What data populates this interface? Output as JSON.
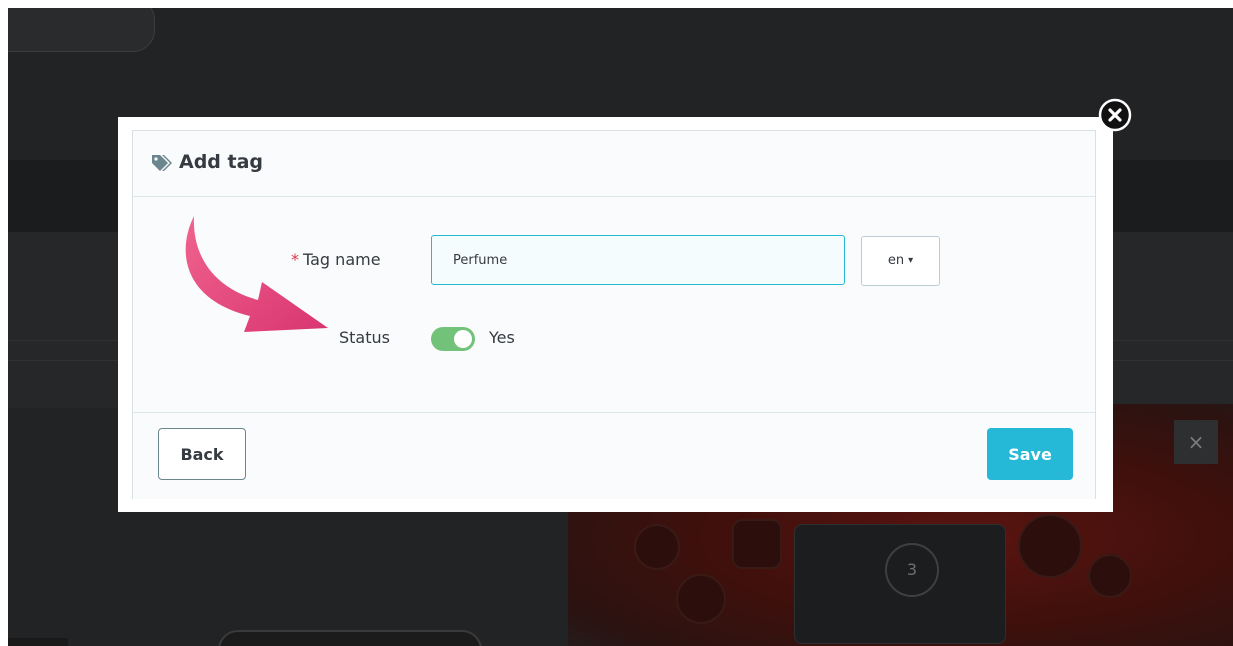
{
  "modal": {
    "title": "Add tag",
    "title_icon": "tags-icon",
    "close_icon": "close-circle-icon"
  },
  "form": {
    "tag_name_required_mark": "*",
    "tag_name_label": "Tag name",
    "tag_name_value": "Perfume",
    "language_selected": "en",
    "language_caret": "▾",
    "status_label": "Status",
    "status_on": true,
    "status_text": "Yes"
  },
  "footer": {
    "back_label": "Back",
    "save_label": "Save"
  },
  "background": {
    "step_number": "3",
    "close_glyph": "×"
  },
  "colors": {
    "accent": "#25b9d7",
    "toggle_on": "#72c279",
    "required": "#e0364a",
    "annotation_arrow": "#e8457f"
  }
}
